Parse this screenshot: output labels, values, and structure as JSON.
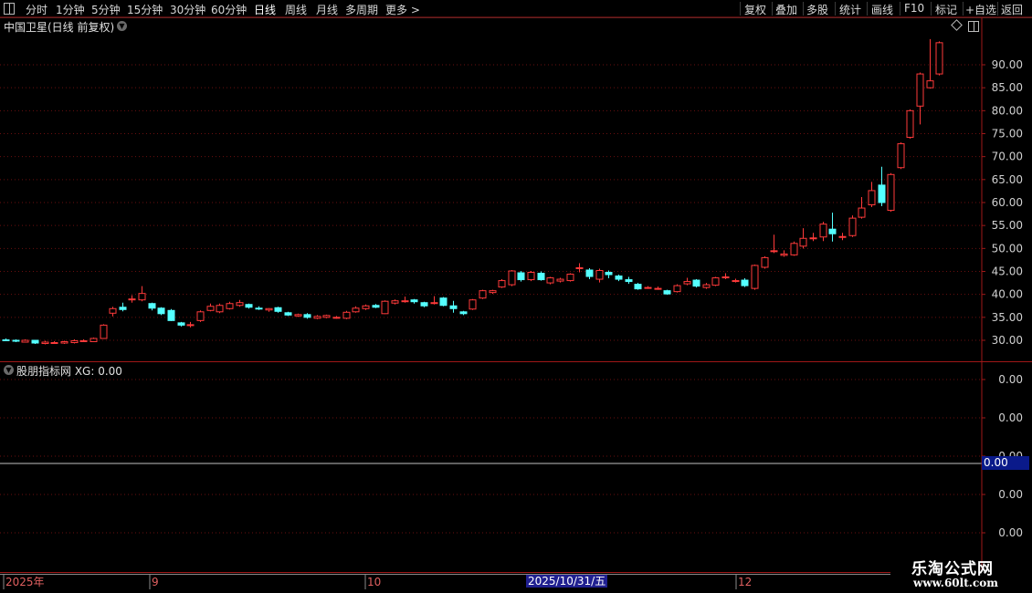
{
  "toolbar": {
    "left_items": [
      "分时",
      "1分钟",
      "5分钟",
      "15分钟",
      "30分钟",
      "60分钟",
      "日线",
      "周线",
      "月线",
      "多周期",
      "更多 >"
    ],
    "active": "日线",
    "right_items": [
      "复权",
      "叠加",
      "多股",
      "统计",
      "画线",
      "F10",
      "标记",
      "+自选",
      "返回"
    ]
  },
  "main_title": "中国卫星(日线 前复权)",
  "indicator_title": "股朋指标网 XG: 0.00",
  "indicator_value_box": "0.00",
  "indicator_axis_labels": [
    "0.00",
    "0.00",
    "0.00",
    "0.00",
    "0.00"
  ],
  "date_axis": {
    "labels": [
      "2025年",
      "9",
      "10",
      "12"
    ],
    "highlight": "2025/10/31/五"
  },
  "watermark": {
    "line1": "乐淘公式网",
    "line2": "www.60lt.com"
  },
  "colors": {
    "up": "#ff3a3a",
    "down": "#54ffff",
    "frame": "#a01818",
    "grid": "#6a0f0f",
    "background": "#000000"
  },
  "chart_data": {
    "type": "candlestick",
    "title": "中国卫星(日线 前复权)",
    "y_ticks": [
      30,
      35,
      40,
      45,
      50,
      55,
      60,
      65,
      70,
      75,
      80,
      85,
      90
    ],
    "ylim": [
      27,
      96
    ],
    "grid": true,
    "candles": [
      {
        "o": 30.1,
        "c": 30.0,
        "h": 30.4,
        "l": 29.8
      },
      {
        "o": 30.0,
        "c": 29.8,
        "h": 30.2,
        "l": 29.6
      },
      {
        "o": 29.6,
        "c": 30.0,
        "h": 30.2,
        "l": 29.5
      },
      {
        "o": 30.0,
        "c": 29.4,
        "h": 30.1,
        "l": 29.2
      },
      {
        "o": 29.3,
        "c": 29.6,
        "h": 29.9,
        "l": 29.1
      },
      {
        "o": 29.5,
        "c": 29.5,
        "h": 29.8,
        "l": 29.2
      },
      {
        "o": 29.4,
        "c": 29.7,
        "h": 29.9,
        "l": 29.2
      },
      {
        "o": 29.5,
        "c": 29.9,
        "h": 30.2,
        "l": 29.3
      },
      {
        "o": 29.8,
        "c": 29.9,
        "h": 30.2,
        "l": 29.6
      },
      {
        "o": 29.7,
        "c": 30.4,
        "h": 30.6,
        "l": 29.6
      },
      {
        "o": 30.4,
        "c": 33.3,
        "h": 33.5,
        "l": 30.3
      },
      {
        "o": 35.9,
        "c": 36.9,
        "h": 37.3,
        "l": 35.2
      },
      {
        "o": 37.2,
        "c": 36.7,
        "h": 38.2,
        "l": 36.3
      },
      {
        "o": 39.0,
        "c": 39.0,
        "h": 39.8,
        "l": 38.2
      },
      {
        "o": 38.8,
        "c": 40.2,
        "h": 41.8,
        "l": 38.5
      },
      {
        "o": 38.0,
        "c": 37.0,
        "h": 38.2,
        "l": 36.5
      },
      {
        "o": 37.0,
        "c": 35.8,
        "h": 37.2,
        "l": 35.5
      },
      {
        "o": 36.5,
        "c": 34.3,
        "h": 36.8,
        "l": 34.2
      },
      {
        "o": 33.8,
        "c": 33.3,
        "h": 34.0,
        "l": 33.0
      },
      {
        "o": 33.4,
        "c": 33.4,
        "h": 34.0,
        "l": 32.8
      },
      {
        "o": 34.3,
        "c": 36.2,
        "h": 36.5,
        "l": 34.0
      },
      {
        "o": 36.5,
        "c": 37.4,
        "h": 38.0,
        "l": 36.3
      },
      {
        "o": 36.2,
        "c": 37.6,
        "h": 38.0,
        "l": 35.9
      },
      {
        "o": 36.9,
        "c": 38.0,
        "h": 38.4,
        "l": 36.7
      },
      {
        "o": 37.6,
        "c": 38.2,
        "h": 38.8,
        "l": 37.3
      },
      {
        "o": 37.8,
        "c": 37.2,
        "h": 38.0,
        "l": 36.9
      },
      {
        "o": 37.0,
        "c": 36.9,
        "h": 37.4,
        "l": 36.6
      },
      {
        "o": 36.6,
        "c": 36.9,
        "h": 37.0,
        "l": 36.2
      },
      {
        "o": 37.1,
        "c": 36.3,
        "h": 37.3,
        "l": 36.0
      },
      {
        "o": 36.0,
        "c": 35.5,
        "h": 36.2,
        "l": 35.3
      },
      {
        "o": 35.3,
        "c": 35.6,
        "h": 35.8,
        "l": 35.1
      },
      {
        "o": 35.6,
        "c": 35.0,
        "h": 35.9,
        "l": 34.7
      },
      {
        "o": 34.8,
        "c": 35.2,
        "h": 35.5,
        "l": 34.6
      },
      {
        "o": 35.0,
        "c": 35.4,
        "h": 35.6,
        "l": 34.8
      },
      {
        "o": 35.0,
        "c": 35.0,
        "h": 35.3,
        "l": 34.7
      },
      {
        "o": 34.8,
        "c": 36.1,
        "h": 36.4,
        "l": 34.6
      },
      {
        "o": 36.2,
        "c": 37.0,
        "h": 37.4,
        "l": 36.0
      },
      {
        "o": 36.9,
        "c": 37.5,
        "h": 37.8,
        "l": 36.6
      },
      {
        "o": 37.6,
        "c": 37.2,
        "h": 37.9,
        "l": 37.0
      },
      {
        "o": 35.8,
        "c": 38.5,
        "h": 38.7,
        "l": 35.7
      },
      {
        "o": 38.1,
        "c": 38.6,
        "h": 38.9,
        "l": 37.8
      },
      {
        "o": 38.6,
        "c": 38.6,
        "h": 39.5,
        "l": 38.2
      },
      {
        "o": 38.8,
        "c": 38.4,
        "h": 39.0,
        "l": 38.0
      },
      {
        "o": 38.2,
        "c": 37.5,
        "h": 38.4,
        "l": 37.2
      },
      {
        "o": 38.2,
        "c": 38.2,
        "h": 39.6,
        "l": 37.8
      },
      {
        "o": 39.2,
        "c": 37.6,
        "h": 39.4,
        "l": 37.4
      },
      {
        "o": 37.5,
        "c": 36.9,
        "h": 38.6,
        "l": 36.0
      },
      {
        "o": 36.2,
        "c": 35.8,
        "h": 36.4,
        "l": 35.5
      },
      {
        "o": 36.8,
        "c": 38.8,
        "h": 39.0,
        "l": 36.6
      },
      {
        "o": 39.2,
        "c": 40.8,
        "h": 41.0,
        "l": 39.0
      },
      {
        "o": 40.4,
        "c": 40.8,
        "h": 41.0,
        "l": 40.1
      },
      {
        "o": 41.6,
        "c": 43.0,
        "h": 43.3,
        "l": 41.4
      },
      {
        "o": 42.1,
        "c": 45.1,
        "h": 45.3,
        "l": 41.8
      },
      {
        "o": 44.7,
        "c": 43.2,
        "h": 45.1,
        "l": 42.8
      },
      {
        "o": 43.2,
        "c": 44.8,
        "h": 45.1,
        "l": 42.9
      },
      {
        "o": 44.6,
        "c": 43.2,
        "h": 45.0,
        "l": 43.0
      },
      {
        "o": 42.5,
        "c": 43.6,
        "h": 43.8,
        "l": 42.2
      },
      {
        "o": 42.9,
        "c": 43.3,
        "h": 43.6,
        "l": 42.6
      },
      {
        "o": 43.0,
        "c": 44.4,
        "h": 44.6,
        "l": 42.8
      },
      {
        "o": 45.8,
        "c": 45.8,
        "h": 46.8,
        "l": 44.8
      },
      {
        "o": 45.3,
        "c": 43.9,
        "h": 45.7,
        "l": 43.3
      },
      {
        "o": 43.3,
        "c": 45.2,
        "h": 45.6,
        "l": 42.6
      },
      {
        "o": 44.8,
        "c": 44.3,
        "h": 45.2,
        "l": 43.5
      },
      {
        "o": 44.0,
        "c": 43.3,
        "h": 44.3,
        "l": 42.9
      },
      {
        "o": 43.2,
        "c": 42.8,
        "h": 43.8,
        "l": 42.3
      },
      {
        "o": 42.2,
        "c": 41.2,
        "h": 42.5,
        "l": 41.0
      },
      {
        "o": 41.5,
        "c": 41.5,
        "h": 41.8,
        "l": 41.2
      },
      {
        "o": 41.3,
        "c": 41.3,
        "h": 41.7,
        "l": 41.0
      },
      {
        "o": 40.8,
        "c": 40.1,
        "h": 41.0,
        "l": 39.9
      },
      {
        "o": 40.6,
        "c": 41.9,
        "h": 42.2,
        "l": 40.4
      },
      {
        "o": 42.3,
        "c": 42.8,
        "h": 43.6,
        "l": 42.0
      },
      {
        "o": 43.1,
        "c": 41.8,
        "h": 43.3,
        "l": 41.5
      },
      {
        "o": 41.5,
        "c": 42.1,
        "h": 42.5,
        "l": 41.2
      },
      {
        "o": 42.0,
        "c": 43.6,
        "h": 43.8,
        "l": 41.8
      },
      {
        "o": 43.8,
        "c": 43.8,
        "h": 44.6,
        "l": 43.3
      },
      {
        "o": 43.0,
        "c": 43.0,
        "h": 43.4,
        "l": 42.6
      },
      {
        "o": 43.1,
        "c": 41.9,
        "h": 43.5,
        "l": 41.6
      },
      {
        "o": 41.3,
        "c": 46.3,
        "h": 46.5,
        "l": 41.0
      },
      {
        "o": 45.9,
        "c": 48.0,
        "h": 48.3,
        "l": 45.6
      },
      {
        "o": 49.5,
        "c": 49.5,
        "h": 53.0,
        "l": 49.0
      },
      {
        "o": 48.5,
        "c": 48.8,
        "h": 49.6,
        "l": 48.2
      },
      {
        "o": 48.6,
        "c": 51.1,
        "h": 51.5,
        "l": 48.4
      },
      {
        "o": 50.5,
        "c": 52.2,
        "h": 54.4,
        "l": 50.0
      },
      {
        "o": 52.3,
        "c": 52.3,
        "h": 53.4,
        "l": 51.6
      },
      {
        "o": 52.5,
        "c": 55.3,
        "h": 55.8,
        "l": 51.6
      },
      {
        "o": 54.2,
        "c": 53.2,
        "h": 57.8,
        "l": 51.5
      },
      {
        "o": 52.6,
        "c": 52.6,
        "h": 53.4,
        "l": 51.8
      },
      {
        "o": 52.8,
        "c": 56.6,
        "h": 57.2,
        "l": 52.5
      },
      {
        "o": 56.8,
        "c": 58.8,
        "h": 61.2,
        "l": 56.5
      },
      {
        "o": 59.5,
        "c": 62.6,
        "h": 64.5,
        "l": 59.0
      },
      {
        "o": 63.8,
        "c": 60.0,
        "h": 67.8,
        "l": 59.2
      },
      {
        "o": 58.3,
        "c": 66.1,
        "h": 66.4,
        "l": 58.0
      },
      {
        "o": 67.6,
        "c": 72.8,
        "h": 73.1,
        "l": 67.3
      },
      {
        "o": 74.2,
        "c": 80.0,
        "h": 80.3,
        "l": 73.9
      },
      {
        "o": 81.0,
        "c": 88.0,
        "h": 88.3,
        "l": 77.0
      },
      {
        "o": 85.0,
        "c": 86.5,
        "h": 95.6,
        "l": 84.8
      },
      {
        "o": 88.0,
        "c": 94.8,
        "h": 95.1,
        "l": 87.7
      }
    ]
  }
}
